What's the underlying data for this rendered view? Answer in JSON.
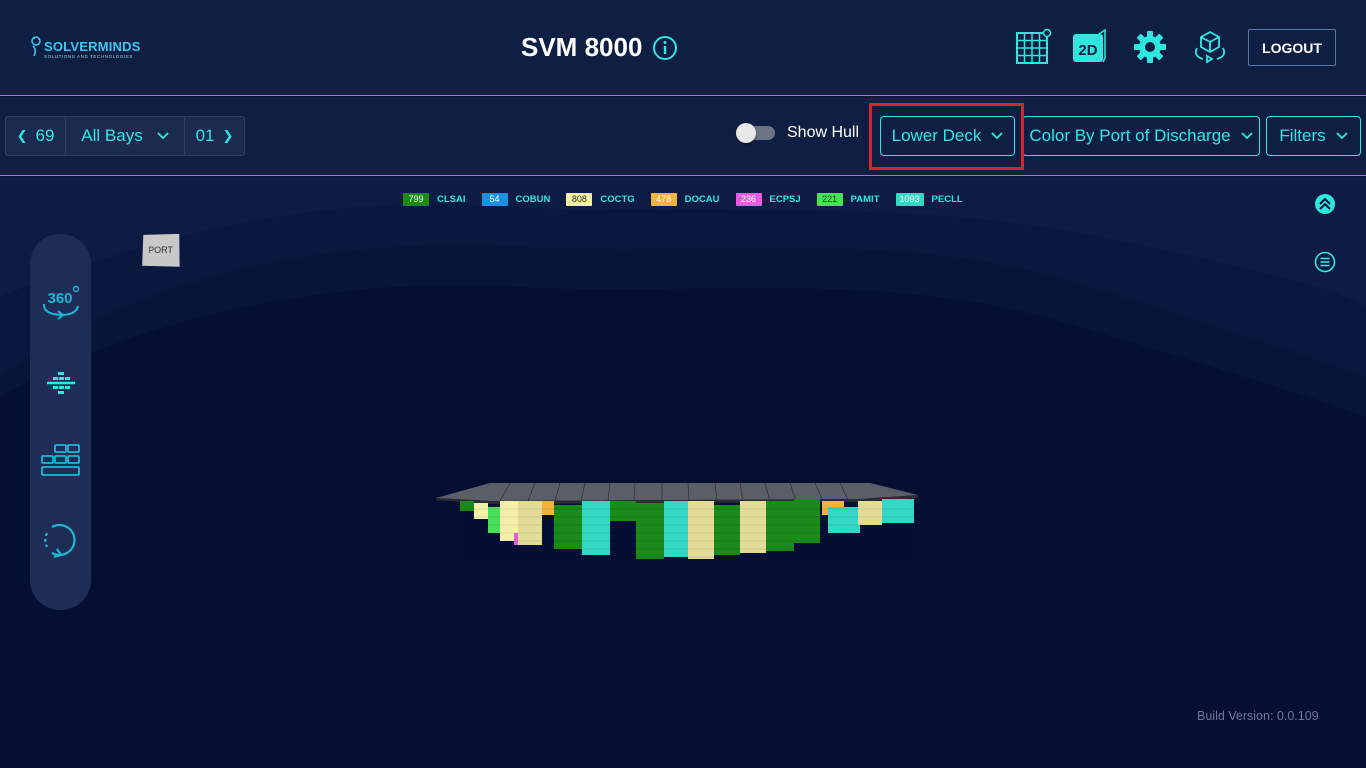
{
  "header": {
    "logo_text": "SOLVERMINDS",
    "logo_subtext": "SOLUTIONS AND TECHNOLOGIES",
    "title": "SVM 8000",
    "icons": [
      "grid-icon",
      "2d-view-icon",
      "gear-icon",
      "cube-view-icon"
    ],
    "two_d_label": "2D",
    "logout_label": "LOGOUT"
  },
  "toolbar": {
    "prev_bay": "69",
    "bay_select": "All Bays",
    "next_bay": "01",
    "show_hull_label": "Show Hull",
    "show_hull_on": false,
    "deck_select": "Lower Deck",
    "color_by_select": "Color By Port of Discharge",
    "filters_label": "Filters"
  },
  "legend": [
    {
      "count": "799",
      "code": "CLSAI",
      "color": "#1a8a1a",
      "text_color": "#ffffff"
    },
    {
      "count": "54",
      "code": "COBUN",
      "color": "#1d8fe0",
      "text_color": "#ffffff"
    },
    {
      "count": "808",
      "code": "COCTG",
      "color": "#f4f0a8",
      "text_color": "#333333"
    },
    {
      "count": "478",
      "code": "DOCAU",
      "color": "#f0b43c",
      "text_color": "#ffffff"
    },
    {
      "count": "236",
      "code": "ECPSJ",
      "color": "#e060e0",
      "text_color": "#ffffff"
    },
    {
      "count": "221",
      "code": "PAMIT",
      "color": "#48e058",
      "text_color": "#1a3a1a"
    },
    {
      "count": "1093",
      "code": "PECLL",
      "color": "#34d6c4",
      "text_color": "#ffffff"
    }
  ],
  "viewport": {
    "port_label": "PORT",
    "side_tools": [
      "rotate-360-icon",
      "bay-split-icon",
      "stack-blocks-icon",
      "reset-rotation-icon"
    ],
    "side_360_label": "360"
  },
  "footer": {
    "build_version": "Build Version: 0.0.109"
  },
  "colors": {
    "accent": "#2ee8e0",
    "header_bg": "#0f1e43",
    "viewport_bg": "#050f33",
    "highlight": "#e0202e"
  }
}
